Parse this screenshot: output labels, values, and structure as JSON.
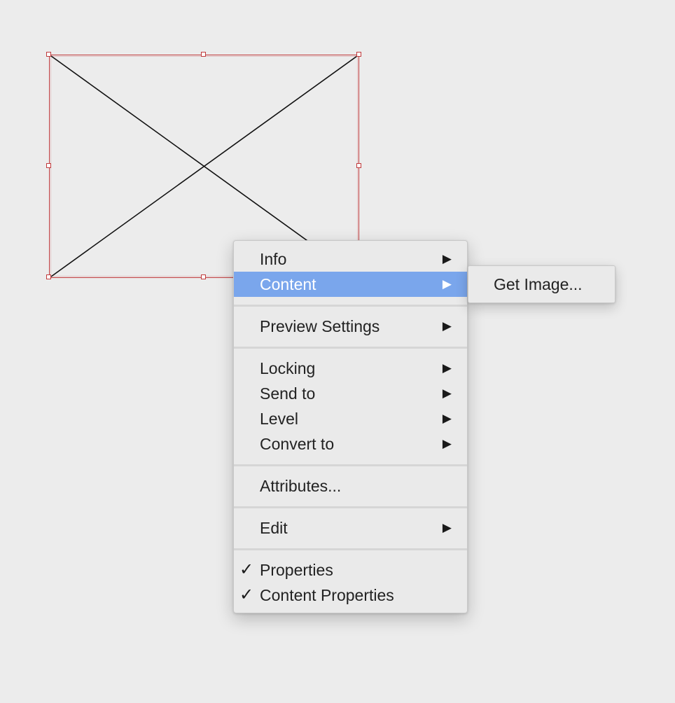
{
  "colors": {
    "background": "#ececec",
    "selection_frame": "#c0393b",
    "menu_highlight": "#7aa6ec"
  },
  "menu": {
    "groups": [
      [
        {
          "label": "Info",
          "arrow": "▶"
        },
        {
          "label": "Content",
          "arrow": "▶",
          "highlighted": true
        }
      ],
      [
        {
          "label": "Preview Settings",
          "arrow": "▶"
        }
      ],
      [
        {
          "label": "Locking",
          "arrow": "▶"
        },
        {
          "label": "Send to",
          "arrow": "▶"
        },
        {
          "label": "Level",
          "arrow": "▶"
        },
        {
          "label": "Convert to",
          "arrow": "▶"
        }
      ],
      [
        {
          "label": "Attributes..."
        }
      ],
      [
        {
          "label": "Edit",
          "arrow": "▶"
        }
      ],
      [
        {
          "label": "Properties",
          "check": "✓"
        },
        {
          "label": "Content Properties",
          "check": "✓"
        }
      ]
    ]
  },
  "submenu": {
    "items": [
      {
        "label": "Get Image..."
      }
    ]
  }
}
